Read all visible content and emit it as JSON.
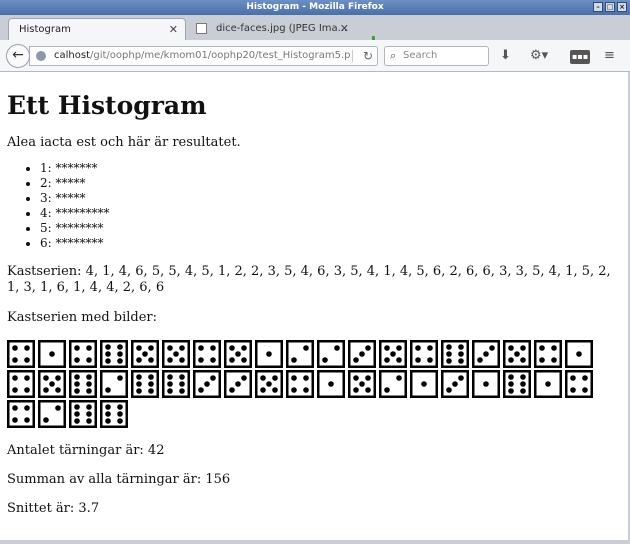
{
  "window": {
    "title": "Histogram - Mozilla Firefox"
  },
  "tabs": [
    {
      "label": "Histogram",
      "active": true
    },
    {
      "label": "dice-faces.jpg (JPEG Ima...",
      "active": false
    }
  ],
  "nav": {
    "url_host": "calhost",
    "url_path": "/git/oophp/me/kmom01/oophp20/test_Histogram5.p",
    "search_placeholder": "Search"
  },
  "page": {
    "title": "Ett Histogram",
    "intro": "Alea iacta est och här är resultatet.",
    "histogram": [
      "1: *******",
      "2: *****",
      "3: *****",
      "4: *********",
      "5: ********",
      "6: ********"
    ],
    "kastserien": "Kastserien: 4, 1, 4, 6, 5, 5, 4, 5, 1, 2, 2, 3, 5, 4, 6, 3, 5, 4, 1, 4, 5, 6, 2, 6, 6, 3, 3, 5, 4, 1, 5, 2, 1, 3, 1, 6, 1, 4, 4, 2, 6, 6",
    "kastserien_bilder_label": "Kastserien med bilder:",
    "dice": [
      4,
      1,
      4,
      6,
      5,
      5,
      4,
      5,
      1,
      2,
      2,
      3,
      5,
      4,
      6,
      3,
      5,
      4,
      1,
      4,
      5,
      6,
      2,
      6,
      6,
      3,
      3,
      5,
      4,
      1,
      5,
      2,
      1,
      3,
      1,
      6,
      1,
      4,
      4,
      2,
      6,
      6
    ],
    "antal": "Antalet tärningar är: 42",
    "summan": "Summan av alla tärningar är: 156",
    "snitt": "Snittet är: 3.7"
  }
}
